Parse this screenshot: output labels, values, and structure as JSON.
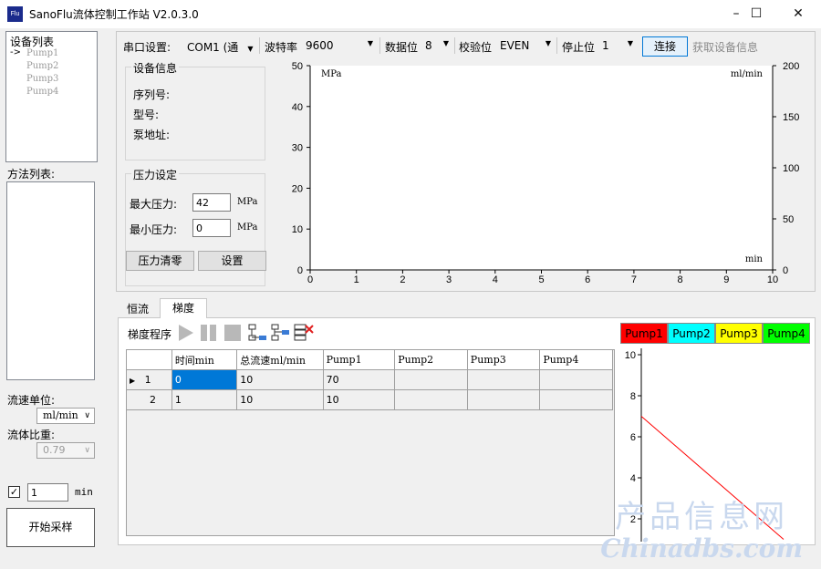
{
  "window": {
    "title": "SanoFlu流体控制工作站 V2.0.3.0",
    "icon_text": "Flu",
    "minimize_icon": "minimize-icon",
    "maximize_icon": "maximize-icon",
    "close_icon": "close-icon"
  },
  "device_list": {
    "title": "设备列表",
    "selected_marker": "->",
    "items": [
      "Pump1",
      "Pump2",
      "Pump3",
      "Pump4"
    ]
  },
  "method_list": {
    "title": "方法列表:"
  },
  "flow_unit": {
    "label": "流速单位:",
    "value": "ml/min"
  },
  "fluid_density": {
    "label": "流体比重:",
    "value": "0.79"
  },
  "sampling": {
    "checked": true,
    "interval": "1",
    "unit": "min",
    "start_button": "开始采样"
  },
  "serial": {
    "port_label": "串口设置:",
    "port_value": "COM1 (通",
    "baud_label": "波特率",
    "baud_value": "9600",
    "databits_label": "数据位",
    "databits_value": "8",
    "parity_label": "校验位",
    "parity_value": "EVEN",
    "stopbits_label": "停止位",
    "stopbits_value": "1",
    "connect_button": "连接",
    "get_info_button": "获取设备信息"
  },
  "device_info": {
    "title": "设备信息",
    "serial_label": "序列号:",
    "model_label": "型号:",
    "address_label": "泵地址:"
  },
  "pressure": {
    "title": "压力设定",
    "max_label": "最大压力:",
    "max_value": "42",
    "max_unit": "MPa",
    "min_label": "最小压力:",
    "min_value": "0",
    "min_unit": "MPa",
    "zero_button": "压力清零",
    "set_button": "设置"
  },
  "chart_data": [
    {
      "type": "line",
      "title": "",
      "left_axis_unit": "MPa",
      "right_axis_unit": "ml/min",
      "xlabel": "min",
      "xlim": [
        0,
        10
      ],
      "ylim_left": [
        0,
        50
      ],
      "ylim_right": [
        0,
        200
      ],
      "x_ticks": [
        "0",
        "1",
        "2",
        "3",
        "4",
        "5",
        "6",
        "7",
        "8",
        "9",
        "10"
      ],
      "y_left_ticks": [
        "0",
        "10",
        "20",
        "30",
        "40",
        "50"
      ],
      "y_right_ticks": [
        "0",
        "50",
        "100",
        "150",
        "200"
      ],
      "series": []
    },
    {
      "type": "line",
      "title": "",
      "y_ticks": [
        "2",
        "4",
        "6",
        "8",
        "10"
      ],
      "ylim": [
        0,
        10
      ],
      "legend": [
        {
          "name": "Pump1",
          "color": "#ff0000"
        },
        {
          "name": "Pump2",
          "color": "#00ffff"
        },
        {
          "name": "Pump3",
          "color": "#ffff00"
        },
        {
          "name": "Pump4",
          "color": "#00ff00"
        }
      ],
      "series": [
        {
          "name": "Pump1",
          "color": "#ff0000",
          "x": [
            0,
            1
          ],
          "values": [
            7,
            1
          ]
        }
      ]
    }
  ],
  "tabs": [
    {
      "label": "恒流",
      "active": false
    },
    {
      "label": "梯度",
      "active": true
    }
  ],
  "gradient": {
    "program_label": "梯度程序",
    "toolbar_icons": [
      "play-icon",
      "pause-icon",
      "stop-icon",
      "insert-row-icon",
      "add-row-icon",
      "delete-row-icon"
    ],
    "columns": [
      "时间min",
      "总流速ml/min",
      "Pump1",
      "Pump2",
      "Pump3",
      "Pump4"
    ],
    "rows": [
      {
        "index": "1",
        "current": true,
        "cells": [
          "0",
          "10",
          "70",
          "",
          "",
          ""
        ]
      },
      {
        "index": "2",
        "current": false,
        "cells": [
          "1",
          "10",
          "10",
          "",
          "",
          ""
        ]
      }
    ]
  },
  "watermark": {
    "line1": "产品信息网",
    "line2": "Chinadbs.com"
  }
}
